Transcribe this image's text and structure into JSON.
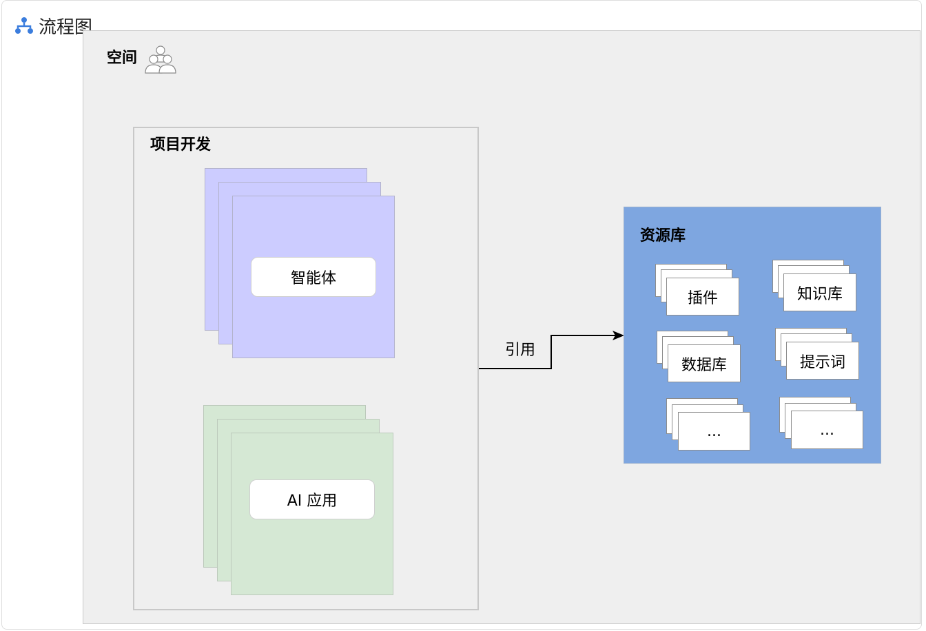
{
  "header": {
    "title": "流程图",
    "icon": "diagram-icon"
  },
  "diagram": {
    "space": {
      "title": "空间",
      "icon": "people-icon"
    },
    "project": {
      "title": "项目开发",
      "agent_label": "智能体",
      "app_label": "AI 应用"
    },
    "reference_label": "引用",
    "resource_library": {
      "title": "资源库",
      "items": [
        "插件",
        "知识库",
        "数据库",
        "提示词",
        "...",
        "..."
      ]
    },
    "colors": {
      "space_bg": "#efefef",
      "agent_card": "#ccccff",
      "app_card": "#d5e8d4",
      "library_bg": "#7ea6e0",
      "header_icon": "#3b7ddd"
    }
  }
}
